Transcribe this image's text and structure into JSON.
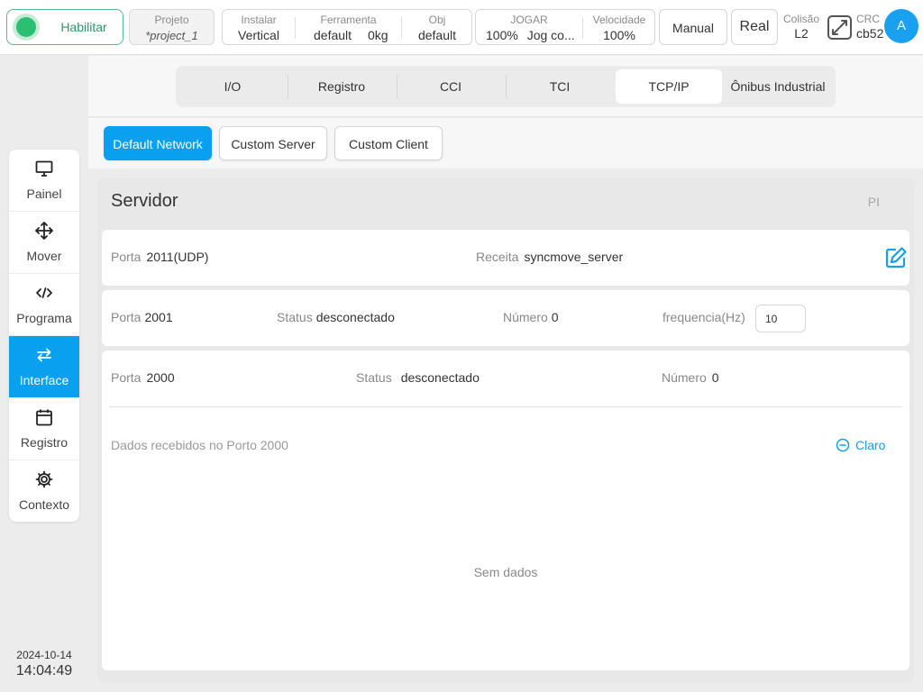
{
  "topbar": {
    "enable_label": "Habilitar",
    "project": {
      "label": "Projeto",
      "value": "*project_1"
    },
    "install": {
      "label": "Instalar",
      "value": "Vertical"
    },
    "tool": {
      "label": "Ferramenta",
      "value": "default",
      "payload": "0kg"
    },
    "obj": {
      "label": "Obj",
      "value": "default"
    },
    "jog": {
      "label": "JOGAR",
      "value": "100%",
      "mode": "Jog co..."
    },
    "speed": {
      "label": "Velocidade",
      "value": "100%"
    },
    "manual_label": "Manual",
    "real_label": "Real",
    "collision": {
      "label": "Colisão",
      "value": "L2"
    },
    "crc": {
      "label": "CRC",
      "value": "cb52"
    },
    "avatar_letter": "A"
  },
  "sidebar": {
    "items": [
      {
        "label": "Painel",
        "icon": "monitor-icon"
      },
      {
        "label": "Mover",
        "icon": "move-arrows-icon"
      },
      {
        "label": "Programa",
        "icon": "code-icon"
      },
      {
        "label": "Interface",
        "icon": "swap-arrows-icon",
        "active": true
      },
      {
        "label": "Registro",
        "icon": "calendar-icon"
      },
      {
        "label": "Contexto",
        "icon": "gear-icon"
      }
    ],
    "date": "2024-10-14",
    "time": "14:04:49"
  },
  "tabs": [
    "I/O",
    "Registro",
    "CCI",
    "TCI",
    "TCP/IP",
    "Ônibus Industrial"
  ],
  "active_tab": "TCP/IP",
  "subtabs": [
    "Default Network",
    "Custom Server",
    "Custom Client"
  ],
  "active_subtab": "Default Network",
  "panel": {
    "title": "Servidor",
    "pi_label": "PI",
    "row1": {
      "port_label": "Porta",
      "port_value": "2011(UDP)",
      "recipe_label": "Receita",
      "recipe_value": "syncmove_server"
    },
    "row2": {
      "port_label": "Porta",
      "port_value": "2001",
      "status_label": "Status",
      "status_value": "desconectado",
      "number_label": "Número",
      "number_value": "0",
      "freq_label": "frequencia(Hz)",
      "freq_value": "10"
    },
    "row3": {
      "port_label": "Porta",
      "port_value": "2000",
      "status_label": "Status",
      "status_value": "desconectado",
      "number_label": "Número",
      "number_value": "0",
      "received_label": "Dados recebidos no Porto 2000",
      "clear_label": "Claro",
      "empty_label": "Sem dados"
    }
  },
  "colors": {
    "accent": "#0aa0f0",
    "enable_green": "#2bbf72",
    "link": "#1a9ee8"
  }
}
